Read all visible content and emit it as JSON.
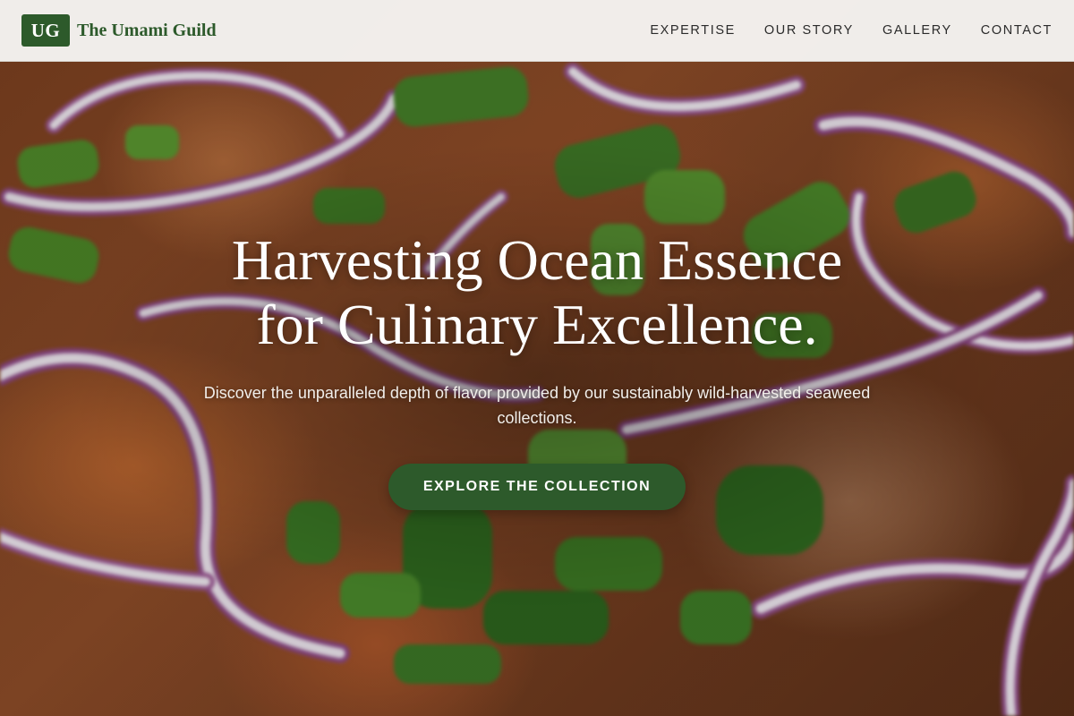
{
  "header": {
    "logo_initials": "UG",
    "brand_name": "The Umami Guild",
    "nav": [
      {
        "label": "EXPERTISE"
      },
      {
        "label": "OUR STORY"
      },
      {
        "label": "GALLERY"
      },
      {
        "label": "CONTACT"
      }
    ]
  },
  "hero": {
    "title_line1": "Harvesting Ocean Essence",
    "title_line2": "for Culinary Excellence.",
    "subtitle": "Discover the unparalleled depth of flavor provided by our sustainably wild-harvested seaweed collections.",
    "cta_label": "EXPLORE THE COLLECTION"
  },
  "colors": {
    "brand_green": "#2d5a2b",
    "header_bg": "#f6f5f3",
    "nav_text": "#2b2b2b",
    "hero_text": "#ffffff"
  }
}
